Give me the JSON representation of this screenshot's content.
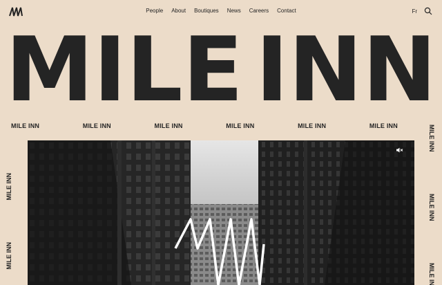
{
  "nav": {
    "items": [
      "People",
      "About",
      "Boutiques",
      "News",
      "Careers",
      "Contact"
    ],
    "lang": "Fr"
  },
  "hero": {
    "words": [
      "MILE",
      "INN"
    ]
  },
  "ticker": {
    "label": "MILE INN"
  },
  "video": {
    "muted": true
  }
}
